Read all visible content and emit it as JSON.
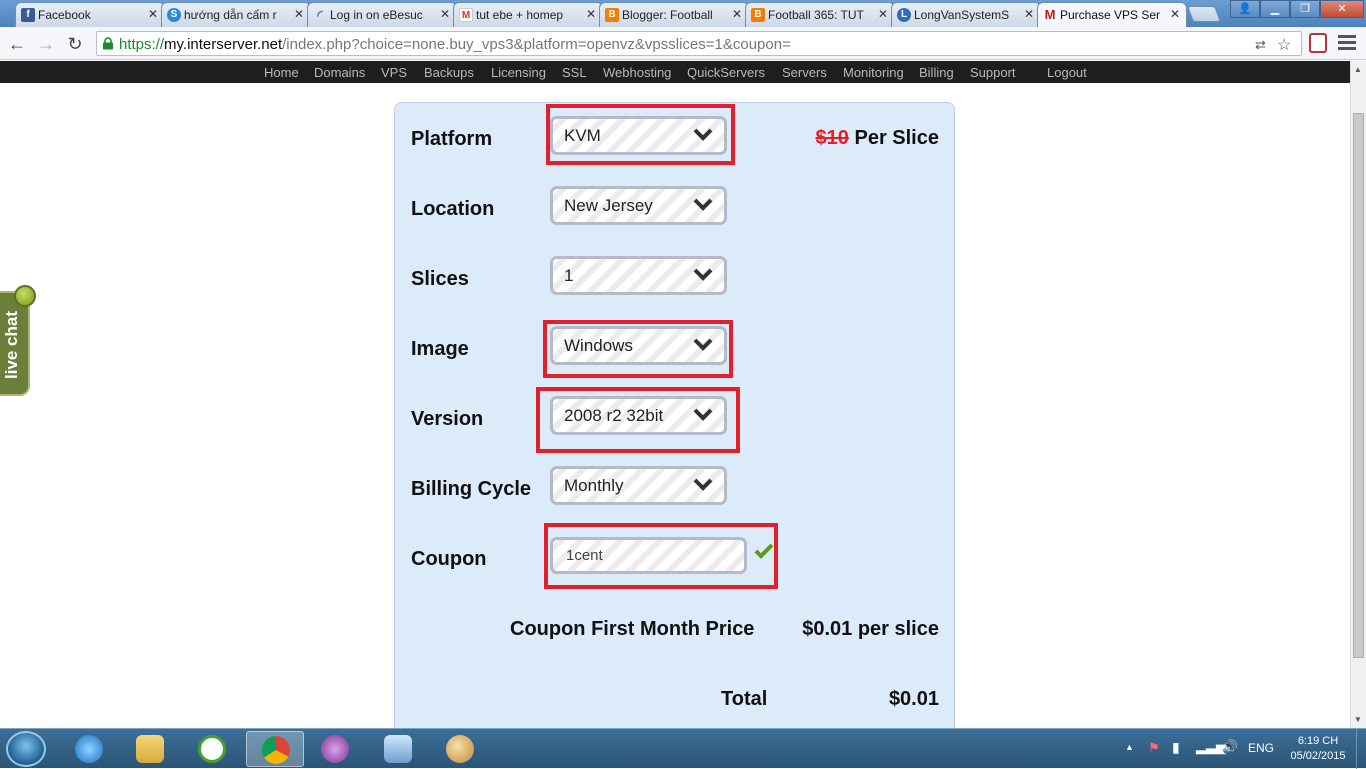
{
  "browser": {
    "tabs": [
      {
        "title": "Facebook",
        "favicon_color": "#3b5998",
        "favicon_glyph": "f"
      },
      {
        "title": "hướng dẫn cấm r",
        "favicon_color": "#2a88d9",
        "favicon_glyph": "S"
      },
      {
        "title": "Log in on eBesuc",
        "favicon_color": "#3d78c8",
        "favicon_glyph": "C"
      },
      {
        "title": "tut ebe + homep",
        "favicon_color": "#d93025",
        "favicon_glyph": "M"
      },
      {
        "title": "Blogger: Football",
        "favicon_color": "#f57d00",
        "favicon_glyph": "B"
      },
      {
        "title": "Football 365: TUT",
        "favicon_color": "#f57d00",
        "favicon_glyph": "B"
      },
      {
        "title": "LongVanSystemS",
        "favicon_color": "#2f6db5",
        "favicon_glyph": "L"
      },
      {
        "title": "Purchase VPS Ser",
        "favicon_color": "#c4161c",
        "favicon_glyph": "M"
      }
    ],
    "active_tab_index": 7,
    "url": {
      "scheme": "https://",
      "host": "my.interserver.net",
      "path": "/index.php?choice=none.buy_vps3&platform=openvz&vpsslices=1&coupon="
    }
  },
  "site_nav": [
    "Home",
    "Domains",
    "VPS",
    "Backups",
    "Licensing",
    "SSL",
    "Webhosting",
    "QuickServers",
    "Servers",
    "Monitoring",
    "Billing",
    "Support",
    "Logout"
  ],
  "form": {
    "platform": {
      "label": "Platform",
      "value": "KVM"
    },
    "price": {
      "old": "$10",
      "suffix": "Per Slice"
    },
    "location": {
      "label": "Location",
      "value": "New Jersey"
    },
    "slices": {
      "label": "Slices",
      "value": "1"
    },
    "image": {
      "label": "Image",
      "value": "Windows"
    },
    "version": {
      "label": "Version",
      "value": "2008 r2 32bit"
    },
    "billing": {
      "label": "Billing Cycle",
      "value": "Monthly"
    },
    "coupon": {
      "label": "Coupon",
      "value": "1cent"
    },
    "coupon_price": {
      "label": "Coupon First Month Price",
      "value": "$0.01 per slice"
    },
    "total": {
      "label": "Total",
      "value": "$0.01"
    }
  },
  "livechat": {
    "label": "live chat"
  },
  "taskbar": {
    "language": "ENG",
    "time": "6:19 CH",
    "date": "05/02/2015"
  },
  "colors": {
    "highlight": "#e2202c",
    "panel": "#dcebf9",
    "nav_bg": "#1e1e1e"
  }
}
